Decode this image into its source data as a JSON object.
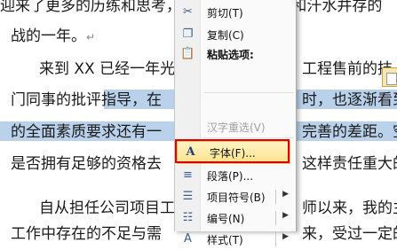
{
  "document": {
    "lines": [
      "迎来了更多的历练和思考，    这是收获的喜悦和汗水并存的",
      "战的一年。",
      "来到 XX 已经一年光",
      "门同事的批评指导，在",
      "的全面素质要求还有一",
      "是否拥有足够的资格去",
      "自从担任公司项目工",
      "工作中存在的不足与需"
    ],
    "right_fragments": [
      "工程售前的技",
      "时，也逐渐看到",
      "完善的差距。空",
      "这样责任重大的",
      "师以来，我的主",
      "来，受过一定的"
    ],
    "paragraph_mark": "↵"
  },
  "context_menu": {
    "items": [
      {
        "icon": "scissors-icon",
        "glyph": "✂",
        "label": "剪切(T)",
        "disabled": false
      },
      {
        "icon": "copy-icon",
        "glyph": "❐",
        "label": "复制(C)",
        "disabled": false
      },
      {
        "icon": "paste-icon",
        "glyph": "📋",
        "label": "粘贴选项:",
        "disabled": false
      },
      {
        "icon": "",
        "glyph": "",
        "label": "汉字重选(V)",
        "disabled": true
      },
      {
        "icon": "font-icon",
        "glyph": "A",
        "label": "字体(F)...",
        "disabled": false
      },
      {
        "icon": "paragraph-icon",
        "glyph": "≡",
        "label": "段落(P)...",
        "disabled": false
      },
      {
        "icon": "bullets-icon",
        "glyph": "☰",
        "label": "项目符号(B)",
        "disabled": false
      },
      {
        "icon": "numbering-icon",
        "glyph": "☷",
        "label": "编号(N)",
        "disabled": false
      },
      {
        "icon": "styles-icon",
        "glyph": "A",
        "label": "样式(T)",
        "disabled": false
      }
    ],
    "submenu_arrow": "▶"
  }
}
